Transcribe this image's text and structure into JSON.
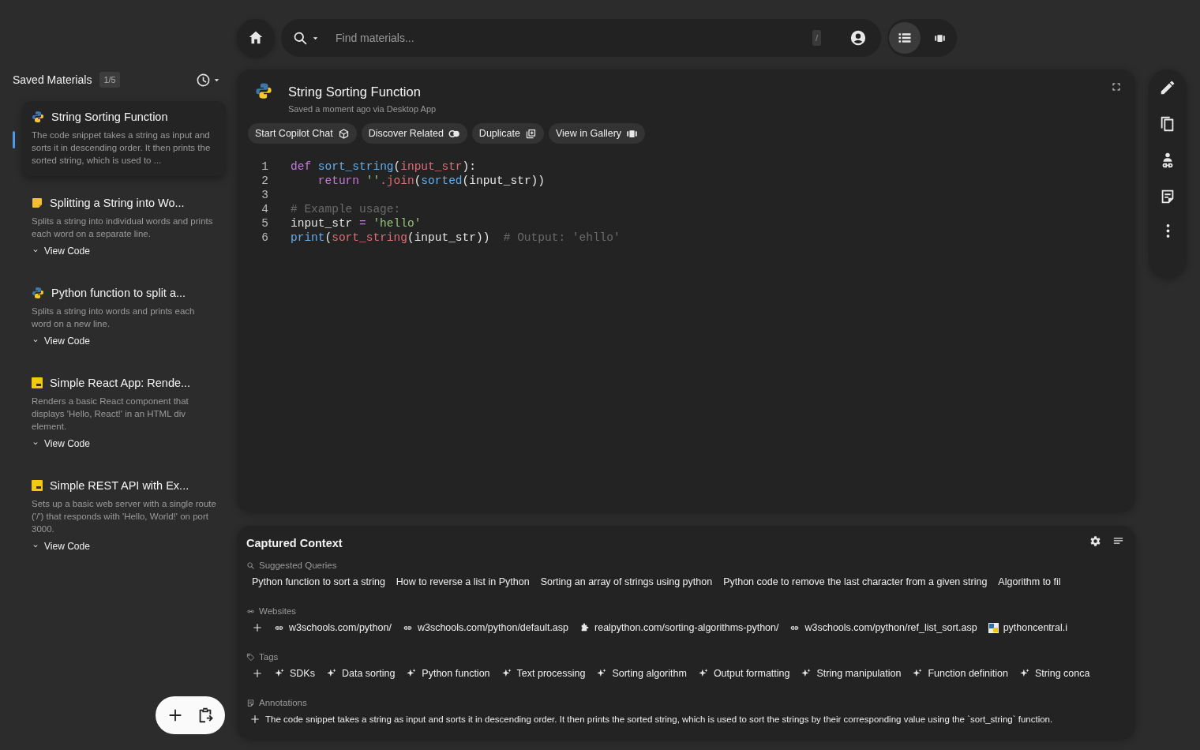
{
  "sidebar": {
    "title": "Saved Materials",
    "count": "1/5",
    "items": [
      {
        "kind": "python",
        "title": "String Sorting Function",
        "description": "The code snippet takes a string as input and sorts it in descending order. It then prints the sorted string, which is used to ...",
        "selected": true
      },
      {
        "kind": "note",
        "title": "Splitting a String into Wo...",
        "description": "Splits a string into individual words and prints each word on a separate line.",
        "view_code": "View Code",
        "selected": false
      },
      {
        "kind": "python",
        "title": "Python function to split a...",
        "description": "Splits a string into words and prints each word on a new line.",
        "view_code": "View Code",
        "selected": false
      },
      {
        "kind": "js",
        "title": "Simple React App: Rende...",
        "description": "Renders a basic React component that displays 'Hello, React!' in an HTML div element.",
        "view_code": "View Code",
        "selected": false
      },
      {
        "kind": "js",
        "title": "Simple REST API with Ex...",
        "description": "Sets up a basic web server with a single route ('/') that responds with 'Hello, World!' on port 3000.",
        "view_code": "View Code",
        "selected": false
      }
    ]
  },
  "search": {
    "placeholder": "Find materials...",
    "shortcut": "/"
  },
  "view_modes": [
    {
      "kind": "list",
      "selected": true
    },
    {
      "kind": "gallery",
      "selected": false
    }
  ],
  "material": {
    "title": "String Sorting Function",
    "subtitle": "Saved a moment ago via Desktop App",
    "actions": [
      {
        "label": "Start Copilot Chat",
        "kind": "cube"
      },
      {
        "label": "Discover Related",
        "kind": "rings"
      },
      {
        "label": "Duplicate",
        "kind": "copy"
      },
      {
        "label": "View in Gallery",
        "kind": "gallery"
      }
    ],
    "code": [
      {
        "number": "1",
        "tokens": [
          {
            "kind": "kw",
            "text": "def "
          },
          {
            "kind": "fn",
            "text": "sort_string"
          },
          {
            "kind": "txt",
            "text": "("
          },
          {
            "kind": "var",
            "text": "input_str"
          },
          {
            "kind": "txt",
            "text": "):"
          }
        ]
      },
      {
        "number": "2",
        "tokens": [
          {
            "kind": "kw",
            "text": "    return "
          },
          {
            "kind": "str",
            "text": "''"
          },
          {
            "kind": "var",
            "text": ".join"
          },
          {
            "kind": "txt",
            "text": "("
          },
          {
            "kind": "fn",
            "text": "sorted"
          },
          {
            "kind": "txt",
            "text": "(input_str))"
          }
        ]
      },
      {
        "number": "3"
      },
      {
        "number": "4",
        "tokens": [
          {
            "kind": "com",
            "text": "# Example usage:"
          }
        ]
      },
      {
        "number": "5",
        "tokens": [
          {
            "kind": "txt",
            "text": "input_str "
          },
          {
            "kind": "kw",
            "text": "= "
          },
          {
            "kind": "str",
            "text": "'hello'"
          }
        ]
      },
      {
        "number": "6",
        "tokens": [
          {
            "kind": "fn",
            "text": "print"
          },
          {
            "kind": "txt",
            "text": "("
          },
          {
            "kind": "var",
            "text": "sort_string"
          },
          {
            "kind": "txt",
            "text": "(input_str))  "
          },
          {
            "kind": "com",
            "text": "# Output: 'ehllo'"
          }
        ]
      }
    ]
  },
  "context": {
    "title": "Captured Context",
    "queries": {
      "label": "Suggested Queries",
      "items": [
        "Python function to sort a string",
        "How to reverse a list in Python",
        "Sorting an array of strings using python",
        "Python code to remove the last character from a given string",
        "Algorithm to fil"
      ]
    },
    "websites": {
      "label": "Websites",
      "items": [
        {
          "kind": "link",
          "text": "w3schools.com/python/"
        },
        {
          "kind": "link",
          "text": "w3schools.com/python/default.asp"
        },
        {
          "kind": "puzzle",
          "text": "realpython.com/sorting-algorithms-python/"
        },
        {
          "kind": "link",
          "text": "w3schools.com/python/ref_list_sort.asp"
        },
        {
          "kind": "favicon",
          "text": "pythoncentral.i"
        }
      ]
    },
    "tags": {
      "label": "Tags",
      "items": [
        "SDKs",
        "Data sorting",
        "Python function",
        "Text processing",
        "Sorting algorithm",
        "Output formatting",
        "String manipulation",
        "Function definition",
        "String conca"
      ]
    },
    "annotations": {
      "label": "Annotations",
      "text": "The code snippet takes a string as input and sorts it in descending order. It then prints the sorted string, which is used to sort the strings by their corresponding value using the `sort_string` function."
    }
  }
}
